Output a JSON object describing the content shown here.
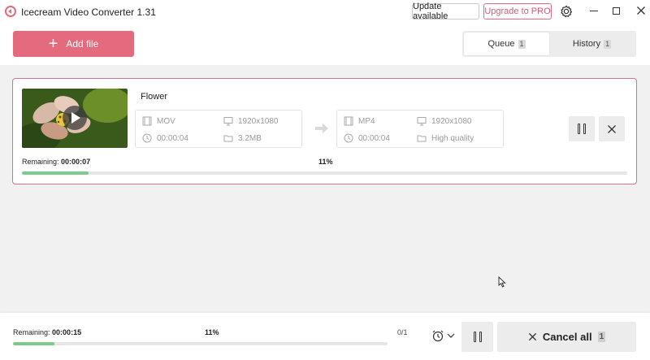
{
  "app": {
    "title": "Icecream Video Converter 1.31",
    "brand_color": "#e46a7e",
    "pro_color": "#e05474"
  },
  "titlebar": {
    "update_label": "Update available",
    "pro_label": "Upgrade to PRO",
    "icons": [
      "app-logo-icon",
      "gear-icon",
      "minimize-icon",
      "maximize-icon",
      "close-icon"
    ]
  },
  "toolbar": {
    "add_label": "Add file",
    "tabs": [
      {
        "label": "Queue",
        "count": "1",
        "active": true
      },
      {
        "label": "History",
        "count": "1",
        "active": false
      }
    ]
  },
  "task": {
    "file_name": "Flower",
    "source": {
      "format": "MOV",
      "resolution": "1920x1080",
      "duration": "00:00:04",
      "size": "3.2MB"
    },
    "target": {
      "format": "MP4",
      "resolution": "1920x1080",
      "duration": "00:00:04",
      "quality": "High quality"
    },
    "remaining_label": "Remaining:",
    "remaining_time": "00:00:07",
    "percent": "11%",
    "progress": 0.11,
    "progress_color": "#7ccb8c"
  },
  "footer": {
    "remaining_label": "Remaining:",
    "remaining_time": "00:00:15",
    "percent": "11%",
    "count": "0/1",
    "progress": 0.11,
    "cancel_label": "Cancel all",
    "cancel_count": "1"
  }
}
